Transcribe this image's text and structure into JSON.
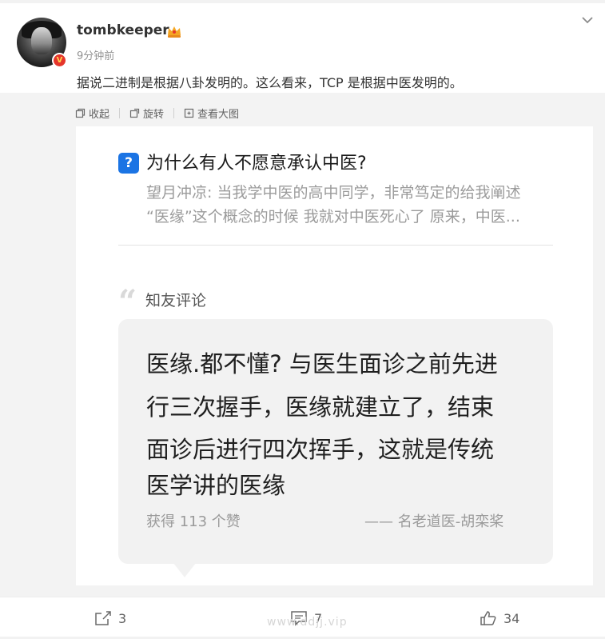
{
  "post": {
    "username": "tombkeeper",
    "time": "9分钟前",
    "text": "据说二进制是根据八卦发明的。这么看来，TCP 是根据中医发明的。"
  },
  "toolbar": {
    "collapse_label": "收起",
    "rotate_label": "旋转",
    "view_large_label": "查看大图"
  },
  "image": {
    "question_title": "为什么有人不愿意承认中医?",
    "question_sub_line1": "望月冲凉: 当我学中医的高中同学，非常笃定的给我阐述",
    "question_sub_line2": "“医缘”这个概念的时候 我就对中医死心了 原来，中医...",
    "section_label": "知友评论",
    "comment_lines": [
      "医缘.都不懂? 与医生面诊之前先进",
      "行三次握手，医缘就建立了，结束",
      "面诊后进行四次挥手，这就是传统",
      "医学讲的医缘"
    ],
    "likes_text": "获得 113 个赞",
    "author_text": "—— 名老道医-胡栾桨"
  },
  "actions": {
    "repost_count": "3",
    "comment_count": "7",
    "like_count": "34"
  },
  "watermark": "www.ddjj.vip",
  "colors": {
    "accent_blue": "#1b74e4",
    "vip_red": "#e5352b"
  }
}
